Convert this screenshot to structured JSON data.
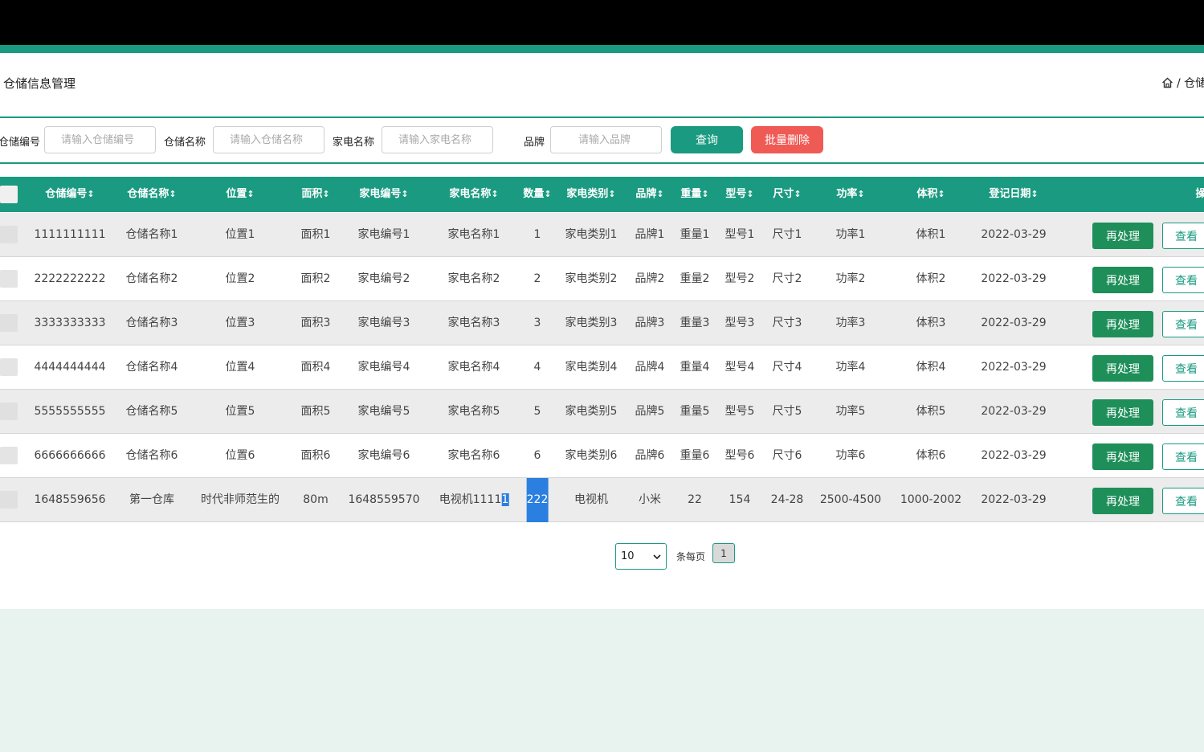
{
  "page": {
    "title": "仓储信息管理",
    "breadcrumb": "/ 仓储"
  },
  "filters": {
    "code_label": "仓储编号",
    "code_placeholder": "请输入仓储编号",
    "name_label": "仓储名称",
    "name_placeholder": "请输入仓储名称",
    "appliance_label": "家电名称",
    "appliance_placeholder": "请输入家电名称",
    "brand_label": "品牌",
    "brand_placeholder": "请输入品牌",
    "query_button": "查询",
    "batch_delete_button": "批量删除"
  },
  "table": {
    "columns": [
      "仓储编号",
      "仓储名称",
      "位置",
      "面积",
      "家电编号",
      "家电名称",
      "数量",
      "家电类别",
      "品牌",
      "重量",
      "型号",
      "尺寸",
      "功率",
      "体积",
      "登记日期",
      "操"
    ],
    "rows": [
      [
        "1111111111",
        "仓储名称1",
        "位置1",
        "面积1",
        "家电编号1",
        "家电名称1",
        "1",
        "家电类别1",
        "品牌1",
        "重量1",
        "型号1",
        "尺寸1",
        "功率1",
        "体积1",
        "2022-03-29"
      ],
      [
        "2222222222",
        "仓储名称2",
        "位置2",
        "面积2",
        "家电编号2",
        "家电名称2",
        "2",
        "家电类别2",
        "品牌2",
        "重量2",
        "型号2",
        "尺寸2",
        "功率2",
        "体积2",
        "2022-03-29"
      ],
      [
        "3333333333",
        "仓储名称3",
        "位置3",
        "面积3",
        "家电编号3",
        "家电名称3",
        "3",
        "家电类别3",
        "品牌3",
        "重量3",
        "型号3",
        "尺寸3",
        "功率3",
        "体积3",
        "2022-03-29"
      ],
      [
        "4444444444",
        "仓储名称4",
        "位置4",
        "面积4",
        "家电编号4",
        "家电名称4",
        "4",
        "家电类别4",
        "品牌4",
        "重量4",
        "型号4",
        "尺寸4",
        "功率4",
        "体积4",
        "2022-03-29"
      ],
      [
        "5555555555",
        "仓储名称5",
        "位置5",
        "面积5",
        "家电编号5",
        "家电名称5",
        "5",
        "家电类别5",
        "品牌5",
        "重量5",
        "型号5",
        "尺寸5",
        "功率5",
        "体积5",
        "2022-03-29"
      ],
      [
        "6666666666",
        "仓储名称6",
        "位置6",
        "面积6",
        "家电编号6",
        "家电名称6",
        "6",
        "家电类别6",
        "品牌6",
        "重量6",
        "型号6",
        "尺寸6",
        "功率6",
        "体积6",
        "2022-03-29"
      ],
      [
        "1648559656",
        "第一仓库",
        "时代非师范生的",
        "80m",
        "1648559570",
        "电视机11111",
        "222",
        "电视机",
        "小米",
        "22",
        "154",
        "24-28",
        "2500-4500",
        "1000-2002",
        "2022-03-29"
      ]
    ],
    "reprocess_button": "再处理",
    "view_button": "查看"
  },
  "pagination": {
    "page_size": "10",
    "per_page_label": "条每页",
    "current_page": "1"
  },
  "colors": {
    "accent": "#1a9a80",
    "danger": "#f05a55",
    "action": "#1f8f5a",
    "selection": "#2b7fe0"
  }
}
